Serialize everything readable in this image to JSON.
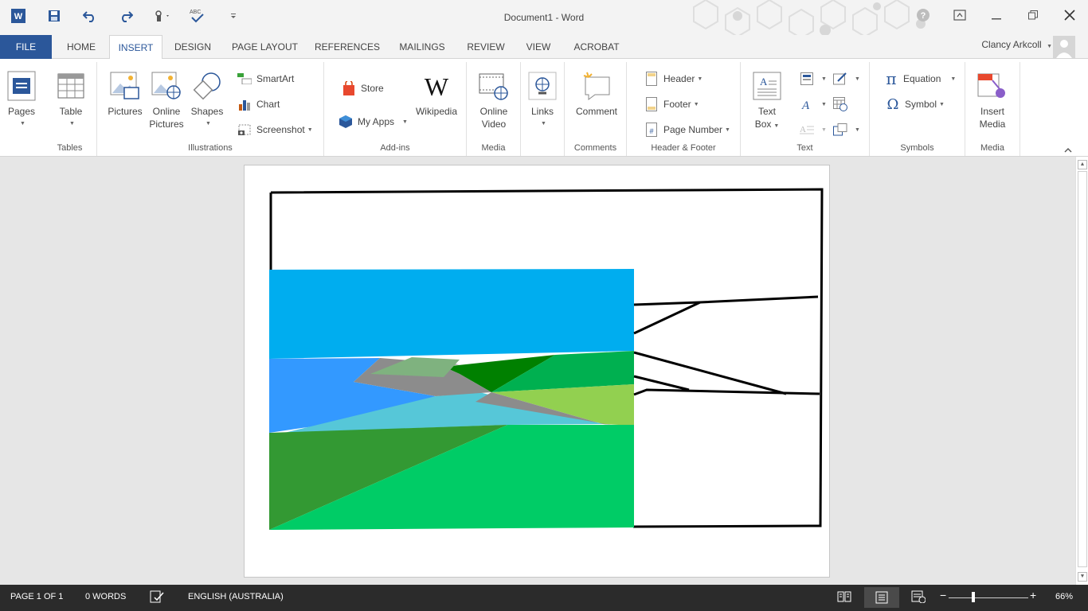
{
  "app": {
    "title": "Document1 - Word",
    "user": "Clancy Arkcoll"
  },
  "tabs": [
    "FILE",
    "HOME",
    "INSERT",
    "DESIGN",
    "PAGE LAYOUT",
    "REFERENCES",
    "MAILINGS",
    "REVIEW",
    "VIEW",
    "ACROBAT"
  ],
  "active_tab": "INSERT",
  "ribbon": {
    "pages": {
      "label": "Pages"
    },
    "tables": {
      "table": "Table",
      "group": "Tables"
    },
    "illustrations": {
      "pictures": "Pictures",
      "online_pictures_1": "Online",
      "online_pictures_2": "Pictures",
      "shapes": "Shapes",
      "smartart": "SmartArt",
      "chart": "Chart",
      "screenshot": "Screenshot",
      "group": "Illustrations"
    },
    "addins": {
      "store": "Store",
      "myapps": "My Apps",
      "wikipedia": "Wikipedia",
      "group": "Add-ins"
    },
    "media": {
      "online_video_1": "Online",
      "online_video_2": "Video",
      "group": "Media"
    },
    "links": {
      "label": "Links"
    },
    "comments": {
      "comment": "Comment",
      "group": "Comments"
    },
    "header_footer": {
      "header": "Header",
      "footer": "Footer",
      "page_number": "Page Number",
      "group": "Header & Footer"
    },
    "text": {
      "textbox_1": "Text",
      "textbox_2": "Box",
      "group": "Text"
    },
    "symbols": {
      "equation": "Equation",
      "symbol": "Symbol",
      "group": "Symbols"
    },
    "media2": {
      "insert_1": "Insert",
      "insert_2": "Media",
      "group": "Media"
    }
  },
  "status": {
    "page": "PAGE 1 OF 1",
    "words": "0 WORDS",
    "language": "ENGLISH (AUSTRALIA)",
    "zoom": "66%"
  },
  "colors": {
    "accent": "#2b579a",
    "statusbar": "#2b2b2b",
    "sky": "#00adef",
    "water_blue": "#3399ff",
    "water_light": "#56c7d8",
    "dark_green": "#339933",
    "bright_green": "#00cc66",
    "forest": "#008000",
    "light_green": "#92d050",
    "grass": "#00b050",
    "grey": "#8c8c8c",
    "sage": "#7fb27f"
  }
}
